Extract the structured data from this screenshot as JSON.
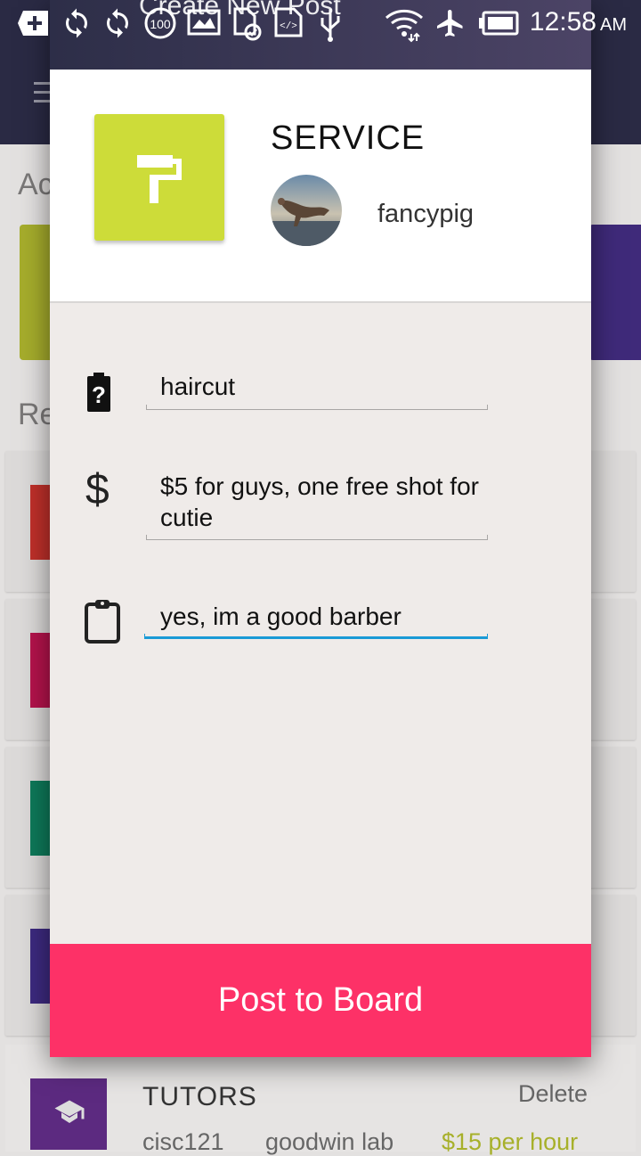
{
  "status_bar": {
    "time": "12:58",
    "ampm": "AM",
    "icons": [
      "add-box-icon",
      "sync-icon",
      "sync-icon",
      "battery-100-icon",
      "image-icon",
      "sim-check-icon",
      "code-icon",
      "usb-icon",
      "wifi-icon",
      "airplane-icon",
      "battery-full-icon"
    ]
  },
  "toolbar": {
    "title": "Create New Post"
  },
  "background": {
    "section_active": "Ac",
    "section_recent": "Re",
    "list_colors": [
      "#c0302a",
      "#b5134c",
      "#0e7a5a",
      "#3d2a80"
    ],
    "last_card": {
      "title": "TUTORS",
      "delete_label": "Delete",
      "subtitle": "cisc121",
      "location": "goodwin lab",
      "price": "$15 per hour"
    }
  },
  "dialog": {
    "category": {
      "title": "SERVICE",
      "icon": "paint-roller-icon",
      "color": "#cddc39"
    },
    "user": {
      "username": "fancypig"
    },
    "fields": {
      "title": {
        "value": "haircut",
        "icon": "battery-unknown-icon"
      },
      "price": {
        "value": "$5 for guys, one free shot for cutie",
        "icon": "dollar-icon"
      },
      "description": {
        "value": "yes, im a good barber",
        "icon": "clipboard-icon"
      }
    },
    "post_button_label": "Post to Board",
    "accent_color": "#fd3167",
    "focus_color": "#1a9ad6"
  }
}
